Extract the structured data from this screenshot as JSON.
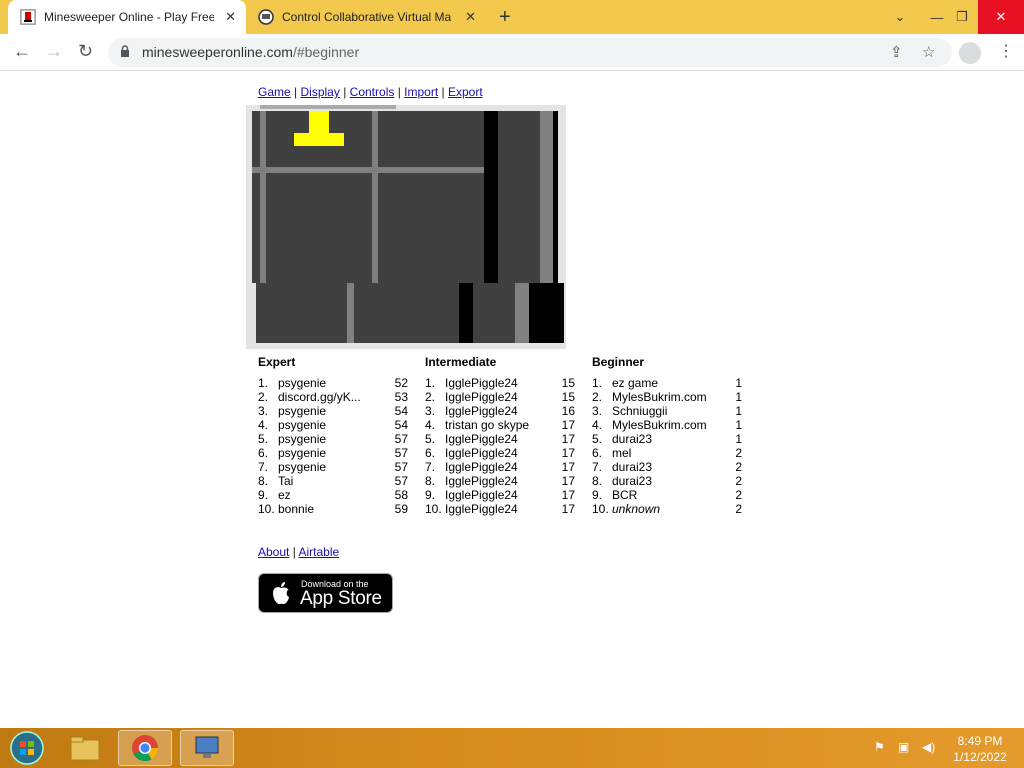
{
  "browser": {
    "tabs": [
      {
        "title": "Minesweeper Online - Play Free O",
        "active": true
      },
      {
        "title": "Control Collaborative Virtual Ma",
        "active": false
      }
    ],
    "address": {
      "host": "minesweeperonline.com",
      "path": "/#beginner"
    }
  },
  "page": {
    "nav": [
      "Game",
      "Display",
      "Controls",
      "Import",
      "Export"
    ],
    "separator": "|",
    "board_colors": {
      "dark": "#404040",
      "grid": "#808080",
      "black": "#000000",
      "yellow": "#ffff00",
      "frame": "#c0c0c0"
    },
    "scores": [
      {
        "heading": "Expert",
        "rows": [
          {
            "rank": "1.",
            "name": "psygenie",
            "time": "52"
          },
          {
            "rank": "2.",
            "name": "discord.gg/yK...",
            "time": "53"
          },
          {
            "rank": "3.",
            "name": "psygenie",
            "time": "54"
          },
          {
            "rank": "4.",
            "name": "psygenie",
            "time": "54"
          },
          {
            "rank": "5.",
            "name": "psygenie",
            "time": "57"
          },
          {
            "rank": "6.",
            "name": "psygenie",
            "time": "57"
          },
          {
            "rank": "7.",
            "name": "psygenie",
            "time": "57"
          },
          {
            "rank": "8.",
            "name": "Tai",
            "time": "57"
          },
          {
            "rank": "9.",
            "name": "ez",
            "time": "58"
          },
          {
            "rank": "10.",
            "name": "bonnie",
            "time": "59"
          }
        ]
      },
      {
        "heading": "Intermediate",
        "rows": [
          {
            "rank": "1.",
            "name": "IgglePiggle24",
            "time": "15"
          },
          {
            "rank": "2.",
            "name": "IgglePiggle24",
            "time": "15"
          },
          {
            "rank": "3.",
            "name": "IgglePiggle24",
            "time": "16"
          },
          {
            "rank": "4.",
            "name": "tristan go skype",
            "time": "17"
          },
          {
            "rank": "5.",
            "name": "IgglePiggle24",
            "time": "17"
          },
          {
            "rank": "6.",
            "name": "IgglePiggle24",
            "time": "17"
          },
          {
            "rank": "7.",
            "name": "IgglePiggle24",
            "time": "17"
          },
          {
            "rank": "8.",
            "name": "IgglePiggle24",
            "time": "17"
          },
          {
            "rank": "9.",
            "name": "IgglePiggle24",
            "time": "17"
          },
          {
            "rank": "10.",
            "name": "IgglePiggle24",
            "time": "17"
          }
        ]
      },
      {
        "heading": "Beginner",
        "rows": [
          {
            "rank": "1.",
            "name": "ez game",
            "time": "1"
          },
          {
            "rank": "2.",
            "name": "MylesBukrim.com",
            "time": "1"
          },
          {
            "rank": "3.",
            "name": "Schniuggii",
            "time": "1"
          },
          {
            "rank": "4.",
            "name": "MylesBukrim.com",
            "time": "1"
          },
          {
            "rank": "5.",
            "name": "durai23",
            "time": "1"
          },
          {
            "rank": "6.",
            "name": "mel",
            "time": "2"
          },
          {
            "rank": "7.",
            "name": "durai23",
            "time": "2"
          },
          {
            "rank": "8.",
            "name": "durai23",
            "time": "2"
          },
          {
            "rank": "9.",
            "name": "BCR",
            "time": "2"
          },
          {
            "rank": "10.",
            "name": "unknown",
            "time": "2",
            "italic": true
          }
        ]
      }
    ],
    "footer_links": [
      "About",
      "Airtable"
    ],
    "appstore": {
      "small": "Download on the",
      "big": "App Store"
    }
  },
  "taskbar": {
    "clock_time": "8:49 PM",
    "clock_date": "1/12/2022",
    "colors": {
      "accent": "#d58a1c"
    }
  }
}
